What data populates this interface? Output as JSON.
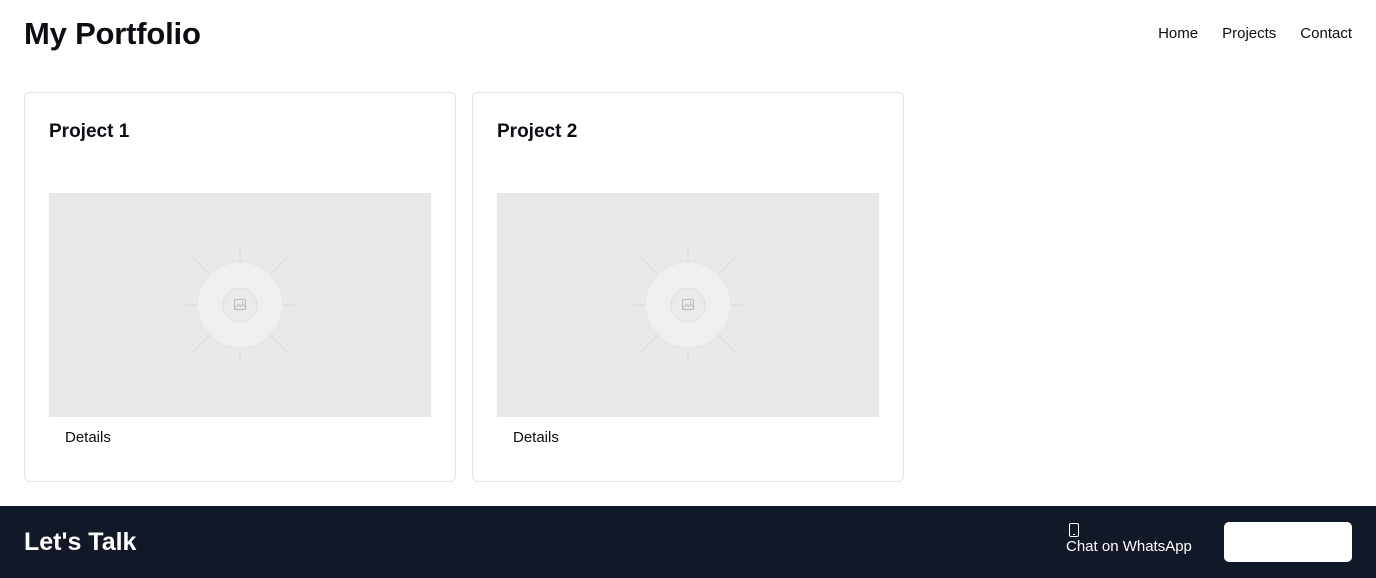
{
  "header": {
    "title": "My Portfolio",
    "nav": [
      "Home",
      "Projects",
      "Contact"
    ]
  },
  "projects": [
    {
      "title": "Project 1",
      "image_icon": "image-placeholder-icon",
      "link": "Details"
    },
    {
      "title": "Project 2",
      "image_icon": "image-placeholder-icon",
      "link": "Details"
    }
  ],
  "footer": {
    "title": "Let's Talk",
    "whatsapp_icon": "phone-icon",
    "whatsapp_label": "Chat on WhatsApp",
    "button_label": ""
  },
  "colors": {
    "footer_background": "#111827",
    "placeholder_background": "#e9e9e9",
    "card_border": "#e2e4e8"
  }
}
